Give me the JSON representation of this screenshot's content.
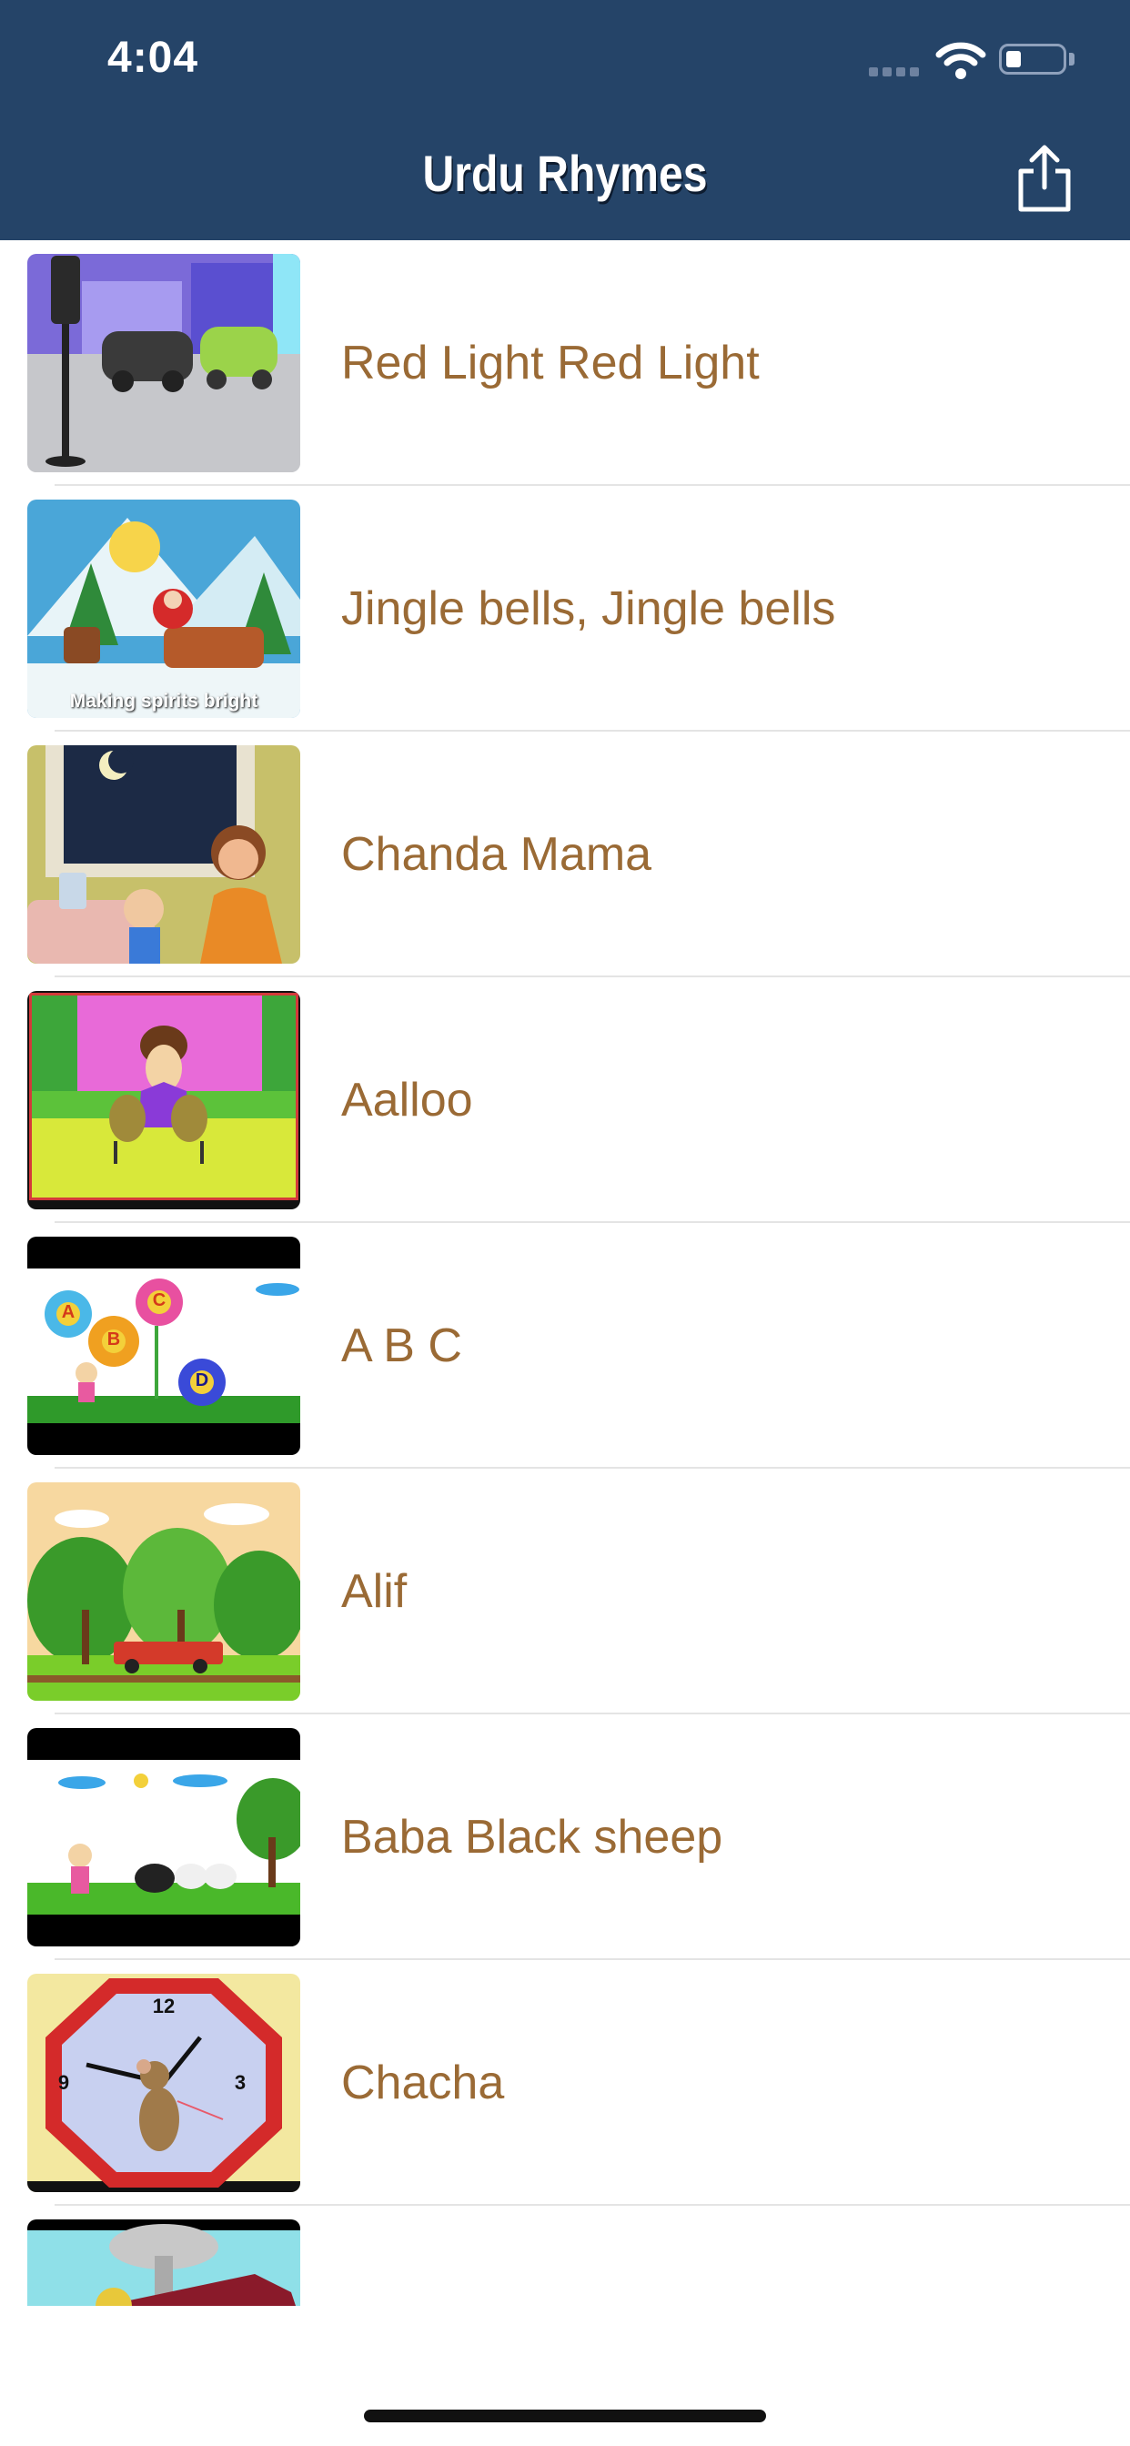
{
  "status_bar": {
    "time": "4:04"
  },
  "header": {
    "title": "Urdu Rhymes"
  },
  "rhymes": [
    {
      "title": "Red Light Red Light"
    },
    {
      "title": "Jingle bells, Jingle bells",
      "thumb_caption": "Making spirits bright"
    },
    {
      "title": "Chanda Mama"
    },
    {
      "title": "Aalloo"
    },
    {
      "title": "A B C",
      "thumb_letters": [
        "A",
        "B",
        "C",
        "D"
      ]
    },
    {
      "title": "Alif"
    },
    {
      "title": "Baba Black sheep"
    },
    {
      "title": "Chacha",
      "thumb_clock_numbers": [
        "12",
        "3",
        "9"
      ]
    },
    {
      "title": ""
    }
  ],
  "colors": {
    "header_bg": "#254468",
    "row_text": "#9a6a35"
  }
}
